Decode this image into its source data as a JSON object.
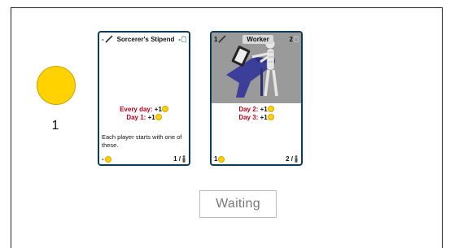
{
  "player": {
    "coins": "1"
  },
  "cards": [
    {
      "title": "Sorcerer's Stipend",
      "cost_left": "-",
      "cost_right": "-",
      "effect_lines": [
        {
          "label": "Every day:",
          "value": "+1"
        },
        {
          "label": "Day 1:",
          "value": "+1"
        }
      ],
      "description": "Each player starts with one of these.",
      "foot_left": "-",
      "foot_right": "1 /"
    },
    {
      "title": "Worker",
      "cost_left": "1",
      "cost_right": "2",
      "effect_lines": [
        {
          "label": "Day 2:",
          "value": "+1"
        },
        {
          "label": "Day 3:",
          "value": "+1"
        }
      ],
      "foot_left": "1",
      "foot_right": "2 /"
    }
  ],
  "status": {
    "label": "Waiting"
  },
  "colors": {
    "coin": "#ffd200",
    "card_border": "#0d3b55",
    "effect_red": "#c0001a"
  }
}
